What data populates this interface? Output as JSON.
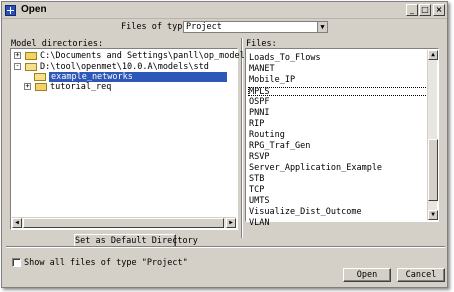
{
  "window": {
    "title": "Open",
    "controls": {
      "minimize": "_",
      "maximize": "□",
      "close": "×"
    }
  },
  "files_of_type": {
    "label": "Files of type:",
    "value": "Project"
  },
  "model_directories": {
    "label": "Model directories:",
    "tree": [
      {
        "text": "C:\\Documents and Settings\\panll\\op_models",
        "toggle": "+"
      },
      {
        "text": "D:\\tool\\openmet\\10.0.A\\models\\std",
        "toggle": "-"
      },
      {
        "text": "example_networks",
        "toggle": "",
        "selected": true
      },
      {
        "text": "tutorial_req",
        "toggle": "+"
      }
    ],
    "set_default_button": "Set as Default Directory"
  },
  "files": {
    "label": "Files:",
    "items": [
      "Loads_To_Flows",
      "MANET",
      "Mobile_IP",
      "MPLS",
      "OSPF",
      "PNNI",
      "RIP",
      "Routing",
      "RPG_Traf_Gen",
      "RSVP",
      "Server_Application_Example",
      "STB",
      "TCP",
      "UMTS",
      "Visualize_Dist_Outcome",
      "VLAN"
    ],
    "selected": "MPLS"
  },
  "show_all": {
    "label": "Show all files of type \"Project\"",
    "checked": false
  },
  "buttons": {
    "open": "Open",
    "cancel": "Cancel"
  },
  "icons": {
    "app": "app-icon",
    "folder": "folder-icon",
    "scroll_up": "▲",
    "scroll_down": "▼",
    "scroll_left": "◀",
    "scroll_right": "▶",
    "dropdown": "▼"
  }
}
